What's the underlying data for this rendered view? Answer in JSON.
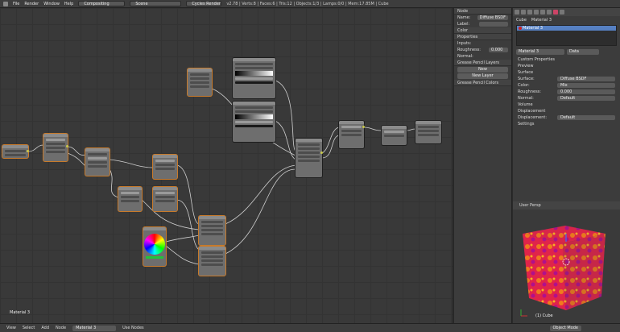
{
  "topbar": {
    "menus": [
      "File",
      "Render",
      "Window",
      "Help"
    ],
    "layout": "Compositing",
    "scene": "Scene",
    "engine": "Cycles Render",
    "stats": "v2.78 | Verts:8 | Faces:6 | Tris:12 | Objects:1/3 | Lamps:0/0 | Mem:17.85M | Cube"
  },
  "node_editor": {
    "material_label": "Material 3"
  },
  "node_panel": {
    "header": "Node",
    "name_label": "Name:",
    "name_value": "Diffuse BSDF",
    "label_label": "Label:",
    "color_label": "Color",
    "properties_label": "Properties",
    "inputs_label": "Inputs:",
    "roughness_label": "Roughness:",
    "roughness_value": "0.000",
    "normal_label": "Normal:",
    "grease_pencil_layers": "Grease Pencil Layers",
    "new_button": "New",
    "new_layer_button": "New Layer",
    "grease_pencil_colors": "Grease Pencil Colors"
  },
  "properties": {
    "breadcrumb": [
      "Cube",
      "Material 3"
    ],
    "slot_selected": "Material 3",
    "material_field": "Material 3",
    "data_select": "Data",
    "sections": {
      "custom_properties": "Custom Properties",
      "preview": "Preview",
      "surface": "Surface",
      "volume": "Volume",
      "displacement": "Displacement",
      "settings": "Settings"
    },
    "surface_label": "Surface:",
    "surface_value": "Diffuse BSDF",
    "color_label": "Color:",
    "color_value": "Mix",
    "roughness_label": "Roughness:",
    "roughness_value": "0.000",
    "normal_label": "Normal:",
    "normal_value": "Default",
    "displacement_label": "Displacement:",
    "displacement_value": "Default"
  },
  "viewport": {
    "header": "User Persp",
    "object_label": "(1) Cube"
  },
  "bottombar": {
    "menus": [
      "View",
      "Select",
      "Add",
      "Node"
    ],
    "material_field": "Material 3",
    "use_nodes": "Use Nodes",
    "mode": "Object Mode"
  },
  "colors": {
    "selection_outline": "#c87a2a",
    "wire": "#cfcfcf",
    "slot_highlight": "#5680c2",
    "socket": "#c9c94a"
  }
}
